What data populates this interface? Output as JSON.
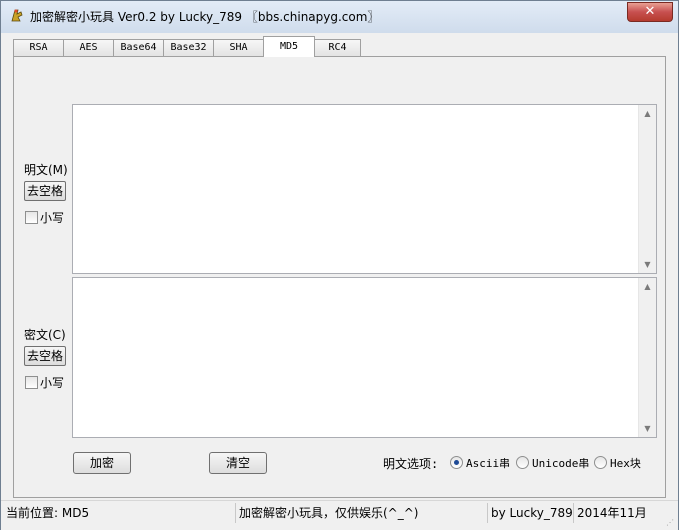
{
  "window": {
    "title": "加密解密小玩具 Ver0.2 by Lucky_789 〖bbs.chinapyg.com〗",
    "close_label": "✕"
  },
  "tabs": [
    {
      "label": "RSA"
    },
    {
      "label": "AES"
    },
    {
      "label": "Base64"
    },
    {
      "label": "Base32"
    },
    {
      "label": "SHA"
    },
    {
      "label": "MD5",
      "active": true
    },
    {
      "label": "RC4"
    }
  ],
  "plaintext": {
    "label": "明文(M)",
    "strip_button": "去空格",
    "lowercase_label": "小写",
    "value": ""
  },
  "ciphertext": {
    "label": "密文(C)",
    "strip_button": "去空格",
    "lowercase_label": "小写",
    "value": ""
  },
  "actions": {
    "encrypt": "加密",
    "clear": "清空"
  },
  "options": {
    "label": "明文选项:",
    "radios": [
      {
        "label": "Ascii串",
        "checked": true
      },
      {
        "label": "Unicode串",
        "checked": false
      },
      {
        "label": "Hex块",
        "checked": false
      }
    ]
  },
  "status": {
    "location": "当前位置: MD5",
    "tagline": "加密解密小玩具，仅供娱乐(^_^)",
    "author": "by Lucky_789",
    "date": "2014年11月"
  }
}
